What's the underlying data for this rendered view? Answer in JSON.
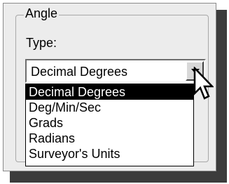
{
  "group": {
    "legend": "Angle"
  },
  "type_label": "Type:",
  "combo": {
    "value": "Decimal Degrees",
    "button_icon": "chevron-down-icon"
  },
  "dropdown": {
    "options": [
      {
        "label": "Decimal Degrees",
        "selected": true
      },
      {
        "label": "Deg/Min/Sec",
        "selected": false
      },
      {
        "label": "Grads",
        "selected": false
      },
      {
        "label": "Radians",
        "selected": false
      },
      {
        "label": "Surveyor's Units",
        "selected": false
      }
    ]
  },
  "cursor_icon": "mouse-pointer-icon",
  "colors": {
    "selection_background": "#000000",
    "selection_text": "#ffffff",
    "panel_background": "#ececec"
  }
}
